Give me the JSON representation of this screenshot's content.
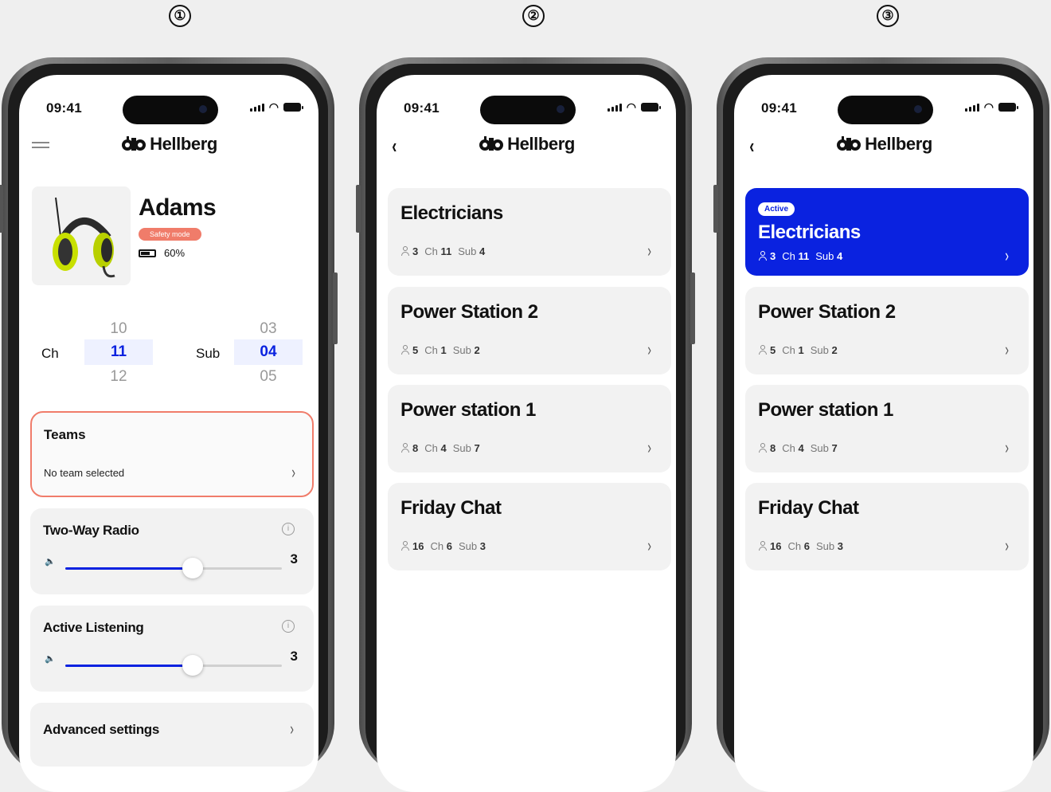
{
  "steps": [
    "①",
    "②",
    "③"
  ],
  "status": {
    "time": "09:41"
  },
  "brand": "Hellberg",
  "screen1": {
    "device_name": "Adams",
    "safety_mode": "Safety mode",
    "battery": "60%",
    "channel": {
      "label": "Ch",
      "prev": "10",
      "current": "11",
      "next": "12"
    },
    "sub": {
      "label": "Sub",
      "prev": "03",
      "current": "04",
      "next": "05"
    },
    "teams": {
      "title": "Teams",
      "subtitle": "No team selected"
    },
    "two_way_radio": {
      "title": "Two-Way Radio",
      "value": "3",
      "level_fraction": 0.59
    },
    "active_listening": {
      "title": "Active Listening",
      "value": "3",
      "level_fraction": 0.59
    },
    "advanced": {
      "title": "Advanced settings"
    }
  },
  "screen2": {
    "teams": [
      {
        "name": "Electricians",
        "members": "3",
        "ch_label": "Ch",
        "ch": "11",
        "sub_label": "Sub",
        "sub": "4"
      },
      {
        "name": "Power Station 2",
        "members": "5",
        "ch_label": "Ch",
        "ch": "1",
        "sub_label": "Sub",
        "sub": "2"
      },
      {
        "name": "Power station 1",
        "members": "8",
        "ch_label": "Ch",
        "ch": "4",
        "sub_label": "Sub",
        "sub": "7"
      },
      {
        "name": "Friday Chat",
        "members": "16",
        "ch_label": "Ch",
        "ch": "6",
        "sub_label": "Sub",
        "sub": "3"
      }
    ]
  },
  "screen3": {
    "active_badge": "Active",
    "teams": [
      {
        "name": "Electricians",
        "members": "3",
        "ch_label": "Ch",
        "ch": "11",
        "sub_label": "Sub",
        "sub": "4"
      },
      {
        "name": "Power Station 2",
        "members": "5",
        "ch_label": "Ch",
        "ch": "1",
        "sub_label": "Sub",
        "sub": "2"
      },
      {
        "name": "Power station 1",
        "members": "8",
        "ch_label": "Ch",
        "ch": "4",
        "sub_label": "Sub",
        "sub": "7"
      },
      {
        "name": "Friday Chat",
        "members": "16",
        "ch_label": "Ch",
        "ch": "6",
        "sub_label": "Sub",
        "sub": "3"
      }
    ]
  },
  "colors": {
    "accent": "#0a22e0",
    "safety": "#f07c6a"
  }
}
